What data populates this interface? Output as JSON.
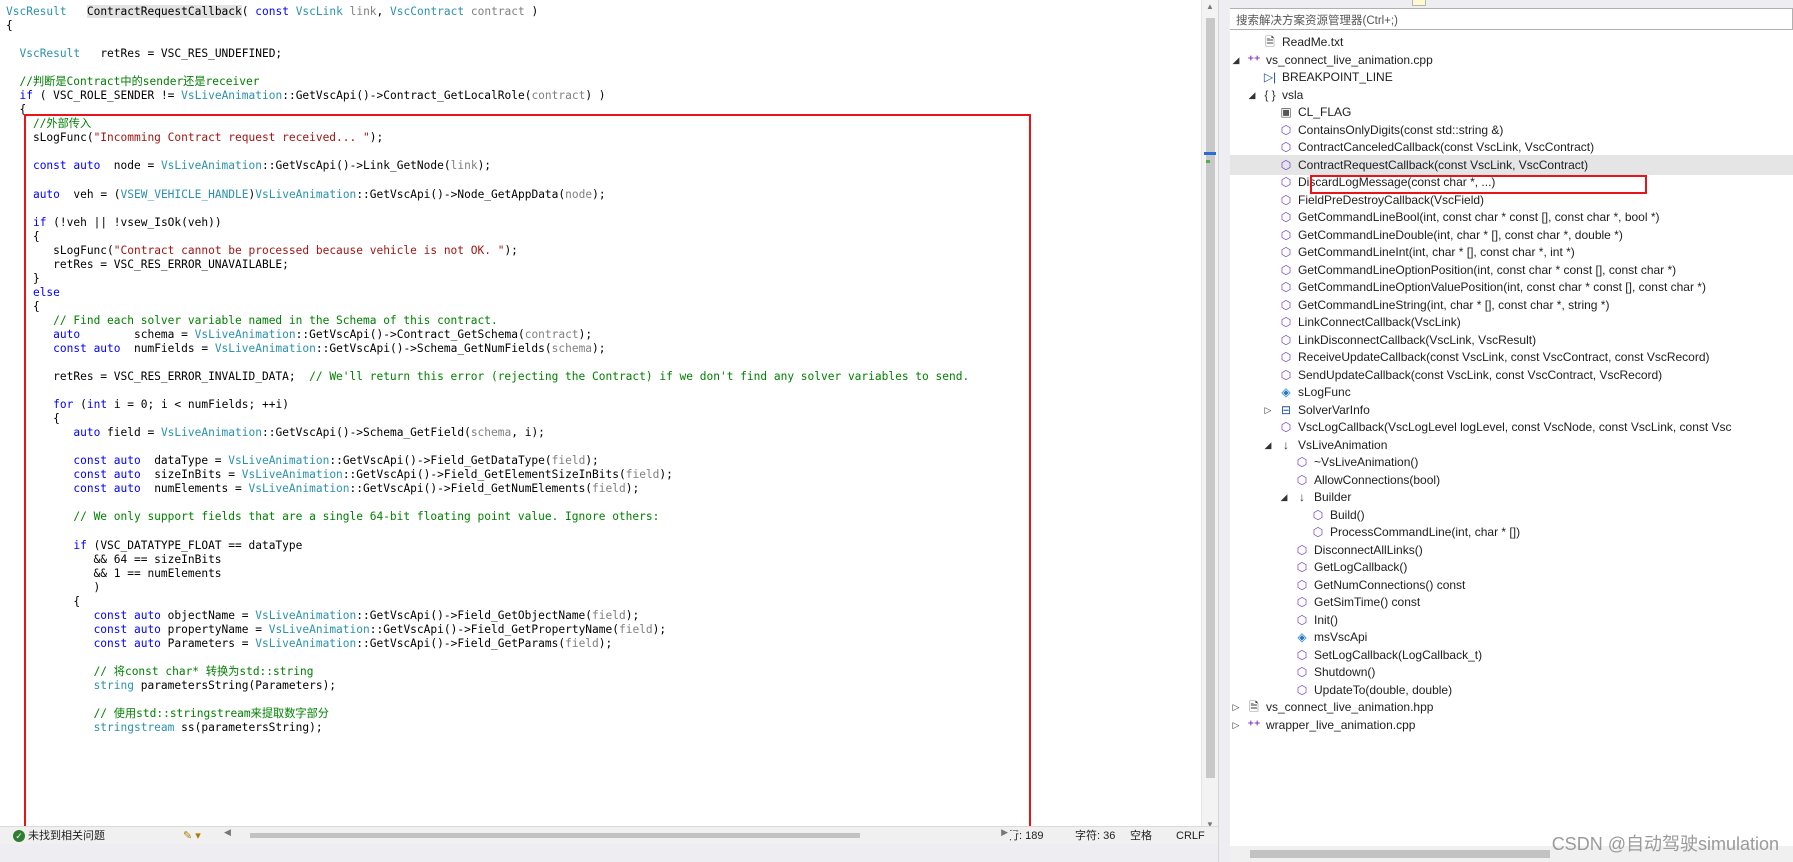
{
  "editor": {
    "code_lines": [
      [
        {
          "t": "VscResult",
          "c": "t-ty"
        },
        {
          "t": "   "
        },
        {
          "t": "ContractRequestCallback",
          "c": "t-hl"
        },
        {
          "t": "( "
        },
        {
          "t": "const",
          "c": "t-kw"
        },
        {
          "t": " "
        },
        {
          "t": "VscLink",
          "c": "t-ty"
        },
        {
          "t": " "
        },
        {
          "t": "link",
          "c": "t-par"
        },
        {
          "t": ", "
        },
        {
          "t": "VscContract",
          "c": "t-ty"
        },
        {
          "t": " "
        },
        {
          "t": "contract",
          "c": "t-par"
        },
        {
          "t": " )"
        }
      ],
      [
        {
          "t": "{"
        }
      ],
      [],
      [
        {
          "t": "  "
        },
        {
          "t": "VscResult",
          "c": "t-ty"
        },
        {
          "t": "   retRes = VSC_RES_UNDEFINED;"
        }
      ],
      [],
      [
        {
          "t": "  //判断是Contract中的sender还是receiver",
          "c": "t-com"
        }
      ],
      [
        {
          "t": "  "
        },
        {
          "t": "if",
          "c": "t-kw"
        },
        {
          "t": " ( VSC_ROLE_SENDER != "
        },
        {
          "t": "VsLiveAnimation",
          "c": "t-ty"
        },
        {
          "t": "::"
        },
        {
          "t": "GetVscApi",
          "c": "t-fn"
        },
        {
          "t": "()->Contract_GetLocalRole("
        },
        {
          "t": "contract",
          "c": "t-par"
        },
        {
          "t": ") )"
        }
      ],
      [
        {
          "t": "  {"
        }
      ],
      [
        {
          "t": "    //外部传入",
          "c": "t-com"
        }
      ],
      [
        {
          "t": "    sLogFunc("
        },
        {
          "t": "\"Incomming Contract request received... \"",
          "c": "t-str"
        },
        {
          "t": ");"
        }
      ],
      [],
      [
        {
          "t": "    "
        },
        {
          "t": "const auto",
          "c": "t-kw"
        },
        {
          "t": "  node = "
        },
        {
          "t": "VsLiveAnimation",
          "c": "t-ty"
        },
        {
          "t": "::"
        },
        {
          "t": "GetVscApi",
          "c": "t-fn"
        },
        {
          "t": "()->Link_GetNode("
        },
        {
          "t": "link",
          "c": "t-par"
        },
        {
          "t": ");"
        }
      ],
      [],
      [
        {
          "t": "    "
        },
        {
          "t": "auto",
          "c": "t-kw"
        },
        {
          "t": "  veh = ("
        },
        {
          "t": "VSEW_VEHICLE_HANDLE",
          "c": "t-ty"
        },
        {
          "t": ")"
        },
        {
          "t": "VsLiveAnimation",
          "c": "t-ty"
        },
        {
          "t": "::"
        },
        {
          "t": "GetVscApi",
          "c": "t-fn"
        },
        {
          "t": "()->Node_GetAppData("
        },
        {
          "t": "node",
          "c": "t-par"
        },
        {
          "t": ");"
        }
      ],
      [],
      [
        {
          "t": "    "
        },
        {
          "t": "if",
          "c": "t-kw"
        },
        {
          "t": " (!veh || !"
        },
        {
          "t": "vsew_IsOk",
          "c": "t-fn"
        },
        {
          "t": "(veh))"
        }
      ],
      [
        {
          "t": "    {"
        }
      ],
      [
        {
          "t": "       sLogFunc("
        },
        {
          "t": "\"Contract cannot be processed because vehicle is not OK. \"",
          "c": "t-str"
        },
        {
          "t": ");"
        }
      ],
      [
        {
          "t": "       retRes = VSC_RES_ERROR_UNAVAILABLE;"
        }
      ],
      [
        {
          "t": "    }"
        }
      ],
      [
        {
          "t": "    "
        },
        {
          "t": "else",
          "c": "t-kw"
        }
      ],
      [
        {
          "t": "    {"
        }
      ],
      [
        {
          "t": "       "
        },
        {
          "t": "// Find each solver variable named in the Schema of this contract.",
          "c": "t-com"
        }
      ],
      [
        {
          "t": "       "
        },
        {
          "t": "auto",
          "c": "t-kw"
        },
        {
          "t": "        schema = "
        },
        {
          "t": "VsLiveAnimation",
          "c": "t-ty"
        },
        {
          "t": "::"
        },
        {
          "t": "GetVscApi",
          "c": "t-fn"
        },
        {
          "t": "()->Contract_GetSchema("
        },
        {
          "t": "contract",
          "c": "t-par"
        },
        {
          "t": ");"
        }
      ],
      [
        {
          "t": "       "
        },
        {
          "t": "const auto",
          "c": "t-kw"
        },
        {
          "t": "  numFields = "
        },
        {
          "t": "VsLiveAnimation",
          "c": "t-ty"
        },
        {
          "t": "::"
        },
        {
          "t": "GetVscApi",
          "c": "t-fn"
        },
        {
          "t": "()->Schema_GetNumFields("
        },
        {
          "t": "schema",
          "c": "t-par"
        },
        {
          "t": ");"
        }
      ],
      [],
      [
        {
          "t": "       retRes = VSC_RES_ERROR_INVALID_DATA;  "
        },
        {
          "t": "// We'll return this error (rejecting the Contract) if we don't find any solver variables to send.",
          "c": "t-com"
        }
      ],
      [],
      [
        {
          "t": "       "
        },
        {
          "t": "for",
          "c": "t-kw"
        },
        {
          "t": " ("
        },
        {
          "t": "int",
          "c": "t-kw"
        },
        {
          "t": " i = 0; i < numFields; ++i)"
        }
      ],
      [
        {
          "t": "       {"
        }
      ],
      [
        {
          "t": "          "
        },
        {
          "t": "auto",
          "c": "t-kw"
        },
        {
          "t": " field = "
        },
        {
          "t": "VsLiveAnimation",
          "c": "t-ty"
        },
        {
          "t": "::"
        },
        {
          "t": "GetVscApi",
          "c": "t-fn"
        },
        {
          "t": "()->Schema_GetField("
        },
        {
          "t": "schema",
          "c": "t-par"
        },
        {
          "t": ", i);"
        }
      ],
      [],
      [
        {
          "t": "          "
        },
        {
          "t": "const auto",
          "c": "t-kw"
        },
        {
          "t": "  dataType = "
        },
        {
          "t": "VsLiveAnimation",
          "c": "t-ty"
        },
        {
          "t": "::"
        },
        {
          "t": "GetVscApi",
          "c": "t-fn"
        },
        {
          "t": "()->Field_GetDataType("
        },
        {
          "t": "field",
          "c": "t-par"
        },
        {
          "t": ");"
        }
      ],
      [
        {
          "t": "          "
        },
        {
          "t": "const auto",
          "c": "t-kw"
        },
        {
          "t": "  sizeInBits = "
        },
        {
          "t": "VsLiveAnimation",
          "c": "t-ty"
        },
        {
          "t": "::"
        },
        {
          "t": "GetVscApi",
          "c": "t-fn"
        },
        {
          "t": "()->Field_GetElementSizeInBits("
        },
        {
          "t": "field",
          "c": "t-par"
        },
        {
          "t": ");"
        }
      ],
      [
        {
          "t": "          "
        },
        {
          "t": "const auto",
          "c": "t-kw"
        },
        {
          "t": "  numElements = "
        },
        {
          "t": "VsLiveAnimation",
          "c": "t-ty"
        },
        {
          "t": "::"
        },
        {
          "t": "GetVscApi",
          "c": "t-fn"
        },
        {
          "t": "()->Field_GetNumElements("
        },
        {
          "t": "field",
          "c": "t-par"
        },
        {
          "t": ");"
        }
      ],
      [],
      [
        {
          "t": "          "
        },
        {
          "t": "// We only support fields that are a single 64-bit floating point value. Ignore others:",
          "c": "t-com"
        }
      ],
      [],
      [
        {
          "t": "          "
        },
        {
          "t": "if",
          "c": "t-kw"
        },
        {
          "t": " (VSC_DATATYPE_FLOAT == dataType"
        }
      ],
      [
        {
          "t": "             && 64 == sizeInBits"
        }
      ],
      [
        {
          "t": "             && 1 == numElements"
        }
      ],
      [
        {
          "t": "             )"
        }
      ],
      [
        {
          "t": "          {"
        }
      ],
      [
        {
          "t": "             "
        },
        {
          "t": "const auto",
          "c": "t-kw"
        },
        {
          "t": " objectName = "
        },
        {
          "t": "VsLiveAnimation",
          "c": "t-ty"
        },
        {
          "t": "::"
        },
        {
          "t": "GetVscApi",
          "c": "t-fn"
        },
        {
          "t": "()->Field_GetObjectName("
        },
        {
          "t": "field",
          "c": "t-par"
        },
        {
          "t": ");"
        }
      ],
      [
        {
          "t": "             "
        },
        {
          "t": "const auto",
          "c": "t-kw"
        },
        {
          "t": " propertyName = "
        },
        {
          "t": "VsLiveAnimation",
          "c": "t-ty"
        },
        {
          "t": "::"
        },
        {
          "t": "GetVscApi",
          "c": "t-fn"
        },
        {
          "t": "()->Field_GetPropertyName("
        },
        {
          "t": "field",
          "c": "t-par"
        },
        {
          "t": ");"
        }
      ],
      [
        {
          "t": "             "
        },
        {
          "t": "const auto",
          "c": "t-kw"
        },
        {
          "t": " Parameters = "
        },
        {
          "t": "VsLiveAnimation",
          "c": "t-ty"
        },
        {
          "t": "::"
        },
        {
          "t": "GetVscApi",
          "c": "t-fn"
        },
        {
          "t": "()->Field_GetParams("
        },
        {
          "t": "field",
          "c": "t-par"
        },
        {
          "t": ");"
        }
      ],
      [],
      [
        {
          "t": "             "
        },
        {
          "t": "// 将const char* 转换为std::string",
          "c": "t-com"
        }
      ],
      [
        {
          "t": "             "
        },
        {
          "t": "string",
          "c": "t-ty"
        },
        {
          "t": " parametersString(Parameters);"
        }
      ],
      [],
      [
        {
          "t": "             "
        },
        {
          "t": "// 使用std::stringstream来提取数字部分",
          "c": "t-com"
        }
      ],
      [
        {
          "t": "             "
        },
        {
          "t": "stringstream",
          "c": "t-ty"
        },
        {
          "t": " ss(parametersString);"
        }
      ]
    ],
    "status": {
      "issues": "未找到相关问题",
      "line": "行: 189",
      "col": "字符: 36",
      "whitespace": "空格",
      "eol": "CRLF"
    }
  },
  "explorer": {
    "search_placeholder": "搜索解决方案资源管理器(Ctrl+;)",
    "nodes": [
      {
        "label": "ReadMe.txt",
        "level": 2,
        "icon": "file-icon",
        "glyph": "🗎",
        "cls": "ico-file",
        "arrow": ""
      },
      {
        "label": "vs_connect_live_animation.cpp",
        "level": 1,
        "icon": "cpp-file-icon",
        "glyph": "⁺⁺",
        "cls": "ico-cpp",
        "arrow": "◢"
      },
      {
        "label": "BREAKPOINT_LINE",
        "level": 2,
        "icon": "macro-icon",
        "glyph": "▷|",
        "cls": "ico-macro",
        "arrow": ""
      },
      {
        "label": "vsla",
        "level": 2,
        "icon": "namespace-icon",
        "glyph": "{ }",
        "cls": "ico-ns",
        "arrow": "◢"
      },
      {
        "label": "CL_FLAG",
        "level": 3,
        "icon": "constant-icon",
        "glyph": "▣",
        "cls": "ico-const",
        "arrow": ""
      },
      {
        "label": "ContainsOnlyDigits(const std::string &)",
        "level": 3,
        "icon": "method-icon",
        "glyph": "⬡",
        "cls": "ico-cube",
        "arrow": ""
      },
      {
        "label": "ContractCanceledCallback(const VscLink, VscContract)",
        "level": 3,
        "icon": "method-icon",
        "glyph": "⬡",
        "cls": "ico-cube",
        "arrow": ""
      },
      {
        "label": "ContractRequestCallback(const VscLink, VscContract)",
        "level": 3,
        "icon": "method-icon",
        "glyph": "⬡",
        "cls": "ico-cube",
        "arrow": "",
        "selected": true
      },
      {
        "label": "DiscardLogMessage(const char *, ...)",
        "level": 3,
        "icon": "method-icon",
        "glyph": "⬡",
        "cls": "ico-cube",
        "arrow": ""
      },
      {
        "label": "FieldPreDestroyCallback(VscField)",
        "level": 3,
        "icon": "method-icon",
        "glyph": "⬡",
        "cls": "ico-cube",
        "arrow": ""
      },
      {
        "label": "GetCommandLineBool(int, const char * const [], const char *, bool *)",
        "level": 3,
        "icon": "method-icon",
        "glyph": "⬡",
        "cls": "ico-cube",
        "arrow": ""
      },
      {
        "label": "GetCommandLineDouble(int, char * [], const char *, double *)",
        "level": 3,
        "icon": "method-icon",
        "glyph": "⬡",
        "cls": "ico-cube",
        "arrow": ""
      },
      {
        "label": "GetCommandLineInt(int, char * [], const char *, int *)",
        "level": 3,
        "icon": "method-icon",
        "glyph": "⬡",
        "cls": "ico-cube",
        "arrow": ""
      },
      {
        "label": "GetCommandLineOptionPosition(int, const char * const [], const char *)",
        "level": 3,
        "icon": "method-icon",
        "glyph": "⬡",
        "cls": "ico-cube",
        "arrow": ""
      },
      {
        "label": "GetCommandLineOptionValuePosition(int, const char * const [], const char *)",
        "level": 3,
        "icon": "method-icon",
        "glyph": "⬡",
        "cls": "ico-cube",
        "arrow": ""
      },
      {
        "label": "GetCommandLineString(int, char * [], const char *, string *)",
        "level": 3,
        "icon": "method-icon",
        "glyph": "⬡",
        "cls": "ico-cube",
        "arrow": ""
      },
      {
        "label": "LinkConnectCallback(VscLink)",
        "level": 3,
        "icon": "method-icon",
        "glyph": "⬡",
        "cls": "ico-cube",
        "arrow": ""
      },
      {
        "label": "LinkDisconnectCallback(VscLink, VscResult)",
        "level": 3,
        "icon": "method-icon",
        "glyph": "⬡",
        "cls": "ico-cube",
        "arrow": ""
      },
      {
        "label": "ReceiveUpdateCallback(const VscLink, const VscContract, const VscRecord)",
        "level": 3,
        "icon": "method-icon",
        "glyph": "⬡",
        "cls": "ico-cube",
        "arrow": ""
      },
      {
        "label": "SendUpdateCallback(const VscLink, const VscContract, VscRecord)",
        "level": 3,
        "icon": "method-icon",
        "glyph": "⬡",
        "cls": "ico-cube",
        "arrow": ""
      },
      {
        "label": "sLogFunc",
        "level": 3,
        "icon": "variable-icon",
        "glyph": "◈",
        "cls": "ico-field",
        "arrow": ""
      },
      {
        "label": "SolverVarInfo",
        "level": 3,
        "icon": "struct-icon",
        "glyph": "⊟",
        "cls": "ico-cls",
        "arrow": "▷"
      },
      {
        "label": "VscLogCallback(VscLogLevel logLevel, const VscNode, const VscLink, const Vsc",
        "level": 3,
        "icon": "method-icon",
        "glyph": "⬡",
        "cls": "ico-cube",
        "arrow": ""
      },
      {
        "label": "VsLiveAnimation",
        "level": 3,
        "icon": "class-icon",
        "glyph": "↓",
        "cls": "ico-up",
        "arrow": "◢"
      },
      {
        "label": "~VsLiveAnimation()",
        "level": 4,
        "icon": "method-icon",
        "glyph": "⬡",
        "cls": "ico-cube",
        "arrow": ""
      },
      {
        "label": "AllowConnections(bool)",
        "level": 4,
        "icon": "method-icon",
        "glyph": "⬡",
        "cls": "ico-cube",
        "arrow": ""
      },
      {
        "label": "Builder",
        "level": 4,
        "icon": "class-icon",
        "glyph": "↓",
        "cls": "ico-up",
        "arrow": "◢"
      },
      {
        "label": "Build()",
        "level": 5,
        "icon": "method-icon",
        "glyph": "⬡",
        "cls": "ico-cube",
        "arrow": ""
      },
      {
        "label": "ProcessCommandLine(int, char * [])",
        "level": 5,
        "icon": "method-icon",
        "glyph": "⬡",
        "cls": "ico-cube",
        "arrow": ""
      },
      {
        "label": "DisconnectAllLinks()",
        "level": 4,
        "icon": "method-icon",
        "glyph": "⬡",
        "cls": "ico-cube",
        "arrow": ""
      },
      {
        "label": "GetLogCallback()",
        "level": 4,
        "icon": "method-icon",
        "glyph": "⬡",
        "cls": "ico-cube",
        "arrow": ""
      },
      {
        "label": "GetNumConnections() const",
        "level": 4,
        "icon": "method-icon",
        "glyph": "⬡",
        "cls": "ico-cube",
        "arrow": ""
      },
      {
        "label": "GetSimTime() const",
        "level": 4,
        "icon": "method-icon",
        "glyph": "⬡",
        "cls": "ico-cube",
        "arrow": ""
      },
      {
        "label": "Init()",
        "level": 4,
        "icon": "method-icon",
        "glyph": "⬡",
        "cls": "ico-cube",
        "arrow": ""
      },
      {
        "label": "msVscApi",
        "level": 4,
        "icon": "field-icon",
        "glyph": "◈",
        "cls": "ico-field",
        "arrow": ""
      },
      {
        "label": "SetLogCallback(LogCallback_t)",
        "level": 4,
        "icon": "method-icon",
        "glyph": "⬡",
        "cls": "ico-cube",
        "arrow": ""
      },
      {
        "label": "Shutdown()",
        "level": 4,
        "icon": "method-icon",
        "glyph": "⬡",
        "cls": "ico-cube",
        "arrow": ""
      },
      {
        "label": "UpdateTo(double, double)",
        "level": 4,
        "icon": "method-icon",
        "glyph": "⬡",
        "cls": "ico-cube",
        "arrow": ""
      },
      {
        "label": "vs_connect_live_animation.hpp",
        "level": 1,
        "icon": "header-file-icon",
        "glyph": "🗎",
        "cls": "ico-hdr",
        "arrow": "▷"
      },
      {
        "label": "wrapper_live_animation.cpp",
        "level": 1,
        "icon": "cpp-file-icon",
        "glyph": "⁺⁺",
        "cls": "ico-cpp",
        "arrow": "▷"
      }
    ]
  },
  "watermark": "CSDN @自动驾驶simulation"
}
